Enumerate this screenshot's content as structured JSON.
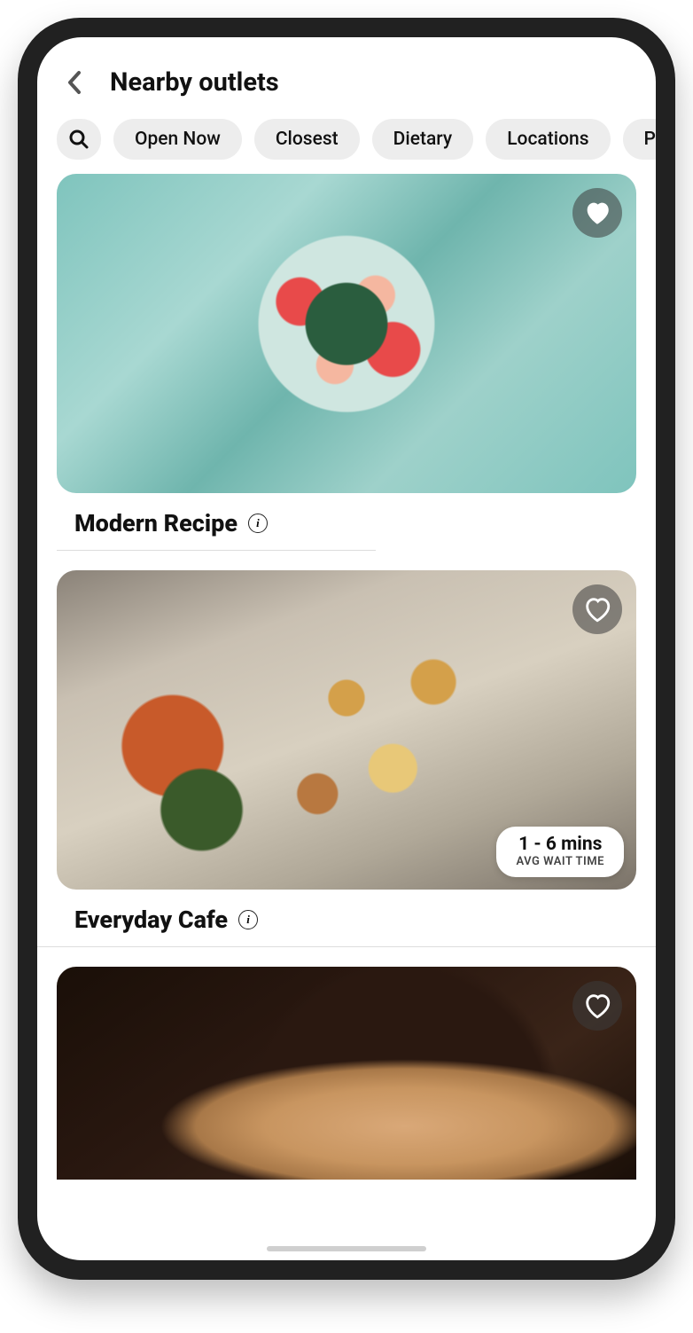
{
  "header": {
    "title": "Nearby outlets"
  },
  "filters": {
    "search_icon": "search-icon",
    "chips": [
      "Open Now",
      "Closest",
      "Dietary",
      "Locations",
      "Po"
    ]
  },
  "outlets": [
    {
      "name": "Modern Recipe",
      "favorited": true,
      "image_style": "salad",
      "wait": null
    },
    {
      "name": "Everyday Cafe",
      "favorited": false,
      "image_style": "burgers",
      "wait": {
        "time": "1 - 6 mins",
        "label": "AVG WAIT TIME"
      }
    },
    {
      "name": "",
      "favorited": false,
      "image_style": "coffee",
      "wait": null
    }
  ]
}
